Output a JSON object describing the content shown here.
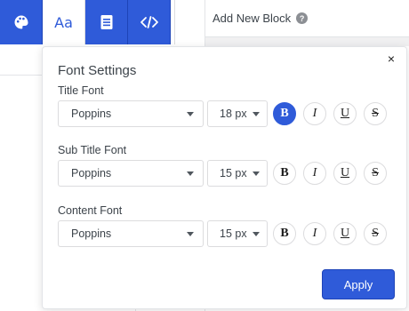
{
  "toolbar": {
    "tabs": [
      {
        "name": "palette-icon"
      },
      {
        "name": "typography-icon",
        "label": "Aa"
      },
      {
        "name": "document-icon"
      },
      {
        "name": "code-icon"
      }
    ],
    "accent": "#2f5bd9"
  },
  "add_block": {
    "label": "Add New Block",
    "help_icon": "?"
  },
  "font_settings": {
    "title": "Font Settings",
    "close_label": "×",
    "sections": [
      {
        "label": "Title Font",
        "font": "Poppins",
        "size": "18 px",
        "bold_active": true
      },
      {
        "label": "Sub Title Font",
        "font": "Poppins",
        "size": "15 px",
        "bold_active": false
      },
      {
        "label": "Content Font",
        "font": "Poppins",
        "size": "15 px",
        "bold_active": false
      }
    ],
    "format_labels": {
      "bold": "B",
      "italic": "I",
      "underline": "U",
      "strike": "S"
    },
    "apply_label": "Apply"
  }
}
